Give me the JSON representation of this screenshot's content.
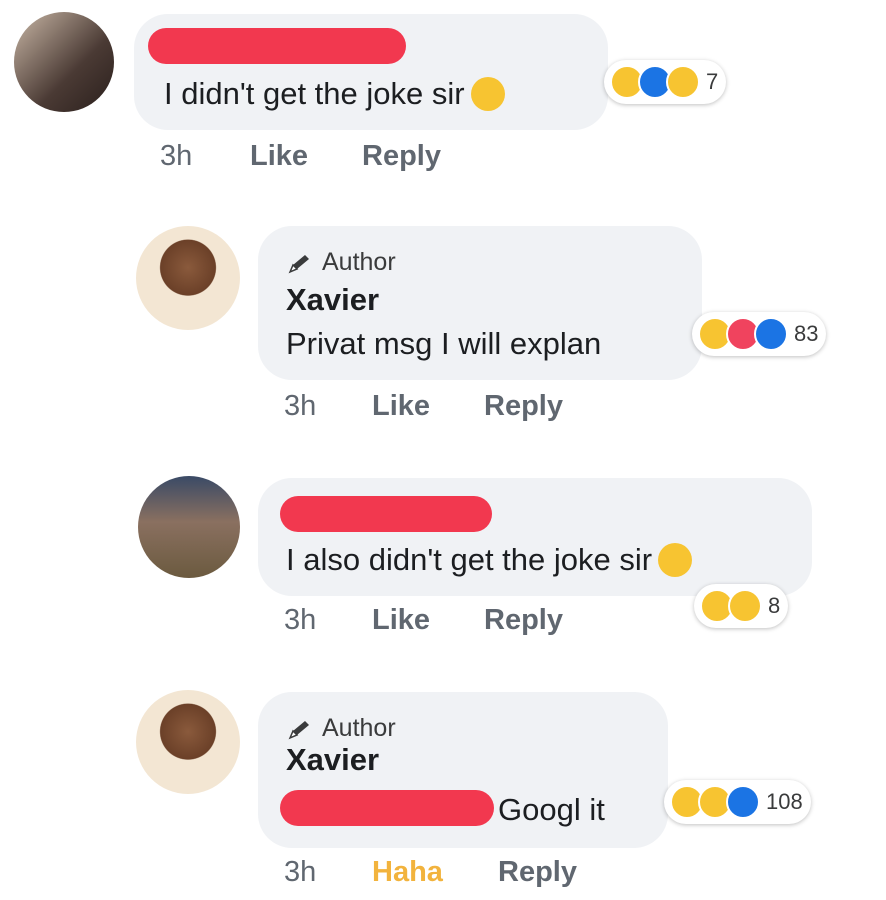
{
  "comments": [
    {
      "text": "I didn't get the joke sir",
      "time": "3h",
      "like_label": "Like",
      "reply_label": "Reply",
      "reaction_count": "7",
      "reactions": [
        "haha-icon",
        "like-icon",
        "sad-icon"
      ],
      "inline_emoji": "frowning-face-icon"
    },
    {
      "author_badge": "Author",
      "name": "Xavier",
      "text": "Privat msg I will explan",
      "time": "3h",
      "like_label": "Like",
      "reply_label": "Reply",
      "reaction_count": "83",
      "reactions": [
        "haha-icon",
        "love-icon",
        "like-icon"
      ]
    },
    {
      "text": "I also didn't get the joke sir",
      "time": "3h",
      "like_label": "Like",
      "reply_label": "Reply",
      "reaction_count": "8",
      "reactions": [
        "sad-icon",
        "haha-icon"
      ],
      "inline_emoji": "pensive-face-icon"
    },
    {
      "author_badge": "Author",
      "name": "Xavier",
      "text": "Googl it",
      "time": "3h",
      "like_label": "Haha",
      "reply_label": "Reply",
      "reaction_count": "108",
      "reactions": [
        "haha-icon",
        "sad-icon",
        "like-icon"
      ]
    }
  ],
  "colors": {
    "bubble": "#f0f2f5",
    "redaction": "#f2384f",
    "haha_label": "#f2b33d",
    "like_blue": "#1b74e4",
    "love_red": "#f0435e",
    "emoji_yellow": "#f7c431"
  }
}
